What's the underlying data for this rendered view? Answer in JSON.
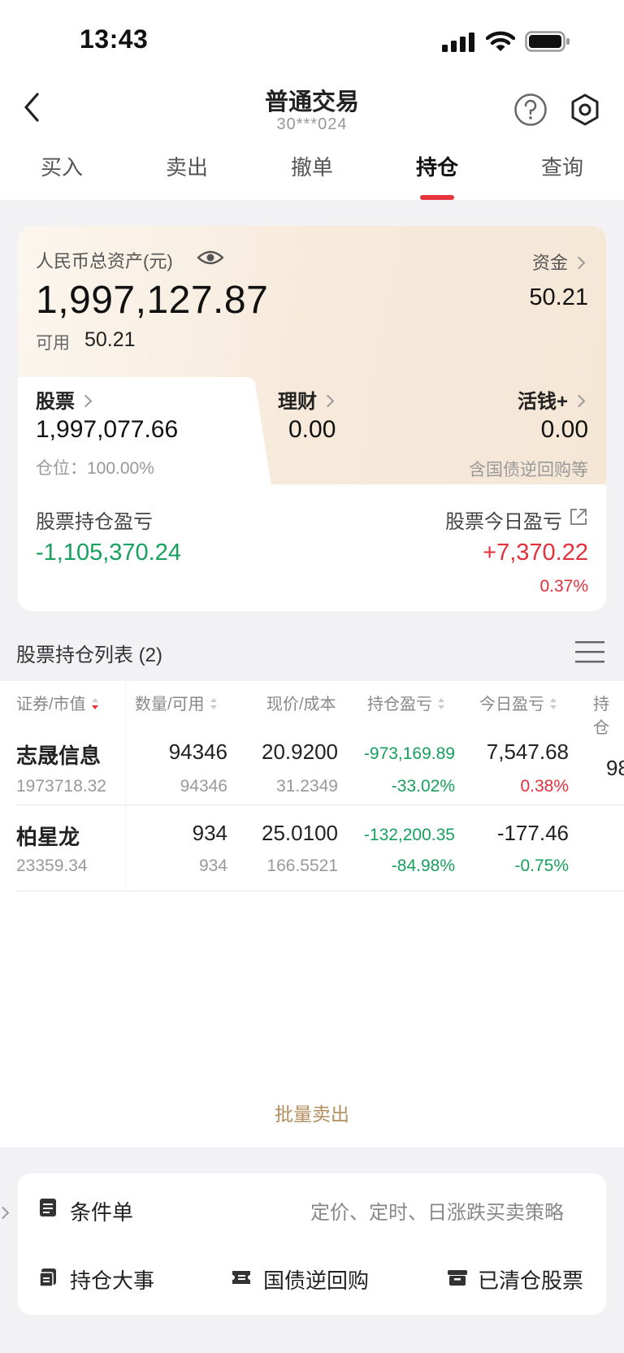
{
  "status_bar": {
    "time": "13:43"
  },
  "nav": {
    "title": "普通交易",
    "account": "30***024"
  },
  "tabs": [
    "买入",
    "卖出",
    "撤单",
    "持仓",
    "查询"
  ],
  "active_tab": "持仓",
  "assets": {
    "total_label": "人民币总资产(元)",
    "total_value": "1,997,127.87",
    "available_label": "可用",
    "available_value": "50.21",
    "funds_label": "资金",
    "funds_value": "50.21",
    "stocks_label": "股票",
    "stocks_value": "1,997,077.66",
    "position_label": "仓位：100.00%",
    "wealth_label": "理财",
    "wealth_value": "0.00",
    "huoqian_label": "活钱+",
    "huoqian_value": "0.00",
    "huoqian_note": "含国债逆回购等",
    "holding_pl_label": "股票持仓盈亏",
    "holding_pl_value": "-1,105,370.24",
    "today_pl_label": "股票今日盈亏",
    "today_pl_value": "+7,370.22",
    "today_pl_pct": "0.37%"
  },
  "holdings": {
    "title": "股票持仓列表 (2)",
    "columns": [
      "证券/市值",
      "数量/可用",
      "现价/成本",
      "持仓盈亏",
      "今日盈亏",
      "持仓"
    ],
    "rows": [
      {
        "name": "志晟信息",
        "market_value": "1973718.32",
        "qty": "94346",
        "available": "94346",
        "price": "20.9200",
        "cost": "31.2349",
        "holding_pl": "-973,169.89",
        "holding_pl_pct": "-33.02%",
        "today_pl": "7,547.68",
        "today_pl_pct": "0.38%",
        "ratio": "98"
      },
      {
        "name": "柏星龙",
        "market_value": "23359.34",
        "qty": "934",
        "available": "934",
        "price": "25.0100",
        "cost": "166.5521",
        "holding_pl": "-132,200.35",
        "holding_pl_pct": "-84.98%",
        "today_pl": "-177.46",
        "today_pl_pct": "-0.75%",
        "ratio": ""
      }
    ]
  },
  "batch_sell": "批量卖出",
  "tools": {
    "conditional_order": "条件单",
    "conditional_desc": "定价、定时、日涨跌买卖策略",
    "holding_events": "持仓大事",
    "reverse_repo": "国债逆回购",
    "cleared_stocks": "已清仓股票"
  },
  "colors": {
    "up": "#e3303b",
    "down": "#17a05e",
    "accent": "#b38d5e"
  }
}
